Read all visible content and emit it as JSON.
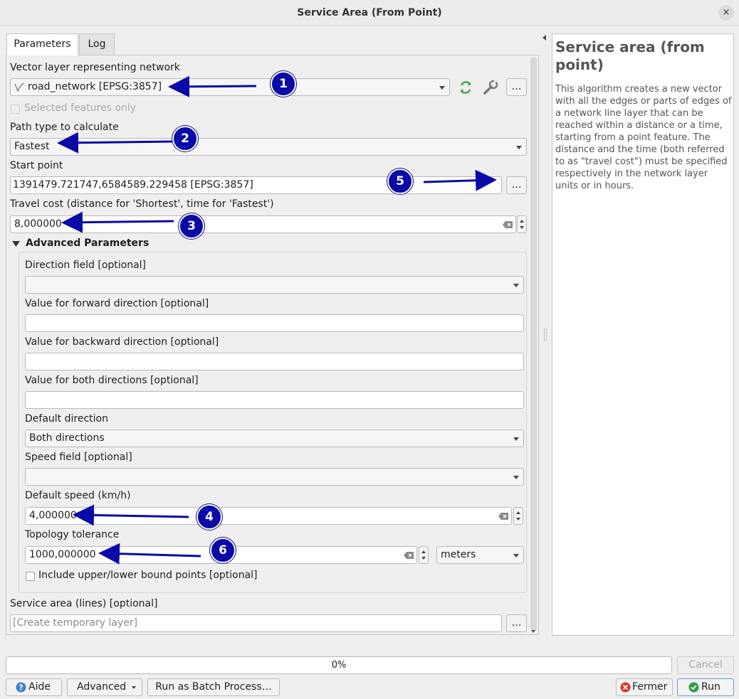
{
  "window": {
    "title": "Service Area (From Point)",
    "close_glyph": "×"
  },
  "tabs": [
    {
      "label": "Parameters"
    },
    {
      "label": "Log"
    }
  ],
  "params": {
    "network_label": "Vector layer representing network",
    "network_value": "road_network [EPSG:3857]",
    "selected_only_label": "Selected features only",
    "path_type_label": "Path type to calculate",
    "path_type_value": "Fastest",
    "start_point_label": "Start point",
    "start_point_value": "1391479.721747,6584589.229458 [EPSG:3857]",
    "travel_cost_label": "Travel cost (distance for 'Shortest', time for 'Fastest')",
    "travel_cost_value": "8,000000",
    "advanced_label": "Advanced Parameters",
    "direction_field_label": "Direction field [optional]",
    "direction_field_value": "",
    "forward_label": "Value for forward direction [optional]",
    "forward_value": "",
    "backward_label": "Value for backward direction [optional]",
    "backward_value": "",
    "both_label": "Value for both directions [optional]",
    "both_value": "",
    "default_direction_label": "Default direction",
    "default_direction_value": "Both directions",
    "speed_field_label": "Speed field [optional]",
    "speed_field_value": "",
    "default_speed_label": "Default speed (km/h)",
    "default_speed_value": "4,000000",
    "tolerance_label": "Topology tolerance",
    "tolerance_value": "1000,000000",
    "tolerance_unit": "meters",
    "include_bounds_label": "Include upper/lower bound points [optional]",
    "output_label": "Service area (lines) [optional]",
    "output_placeholder": "[Create temporary layer]",
    "ellipsis": "…"
  },
  "help": {
    "title": "Service area (from point)",
    "body": "This algorithm creates a new vector with all the edges or parts of edges of a network line layer that can be reached within a distance or a time, starting from a point feature. The distance and the time (both referred to as \"travel cost\") must be specified respectively in the network layer units or in hours."
  },
  "progress": {
    "label": "0%",
    "value": 0
  },
  "buttons": {
    "cancel": "Cancel",
    "help": "Aide",
    "advanced": "Advanced",
    "batch": "Run as Batch Process…",
    "close": "Fermer",
    "run": "Run"
  },
  "markers": [
    "1",
    "2",
    "3",
    "4",
    "5",
    "6"
  ],
  "icons": {
    "refresh": "refresh-icon",
    "wrench": "wrench-icon",
    "line_layer": "line-layer-icon"
  },
  "colors": {
    "marker": "#0a0aa8",
    "refresh": "#3aa63a",
    "close_icon": "#d9342b",
    "run_icon": "#2f9d46"
  }
}
